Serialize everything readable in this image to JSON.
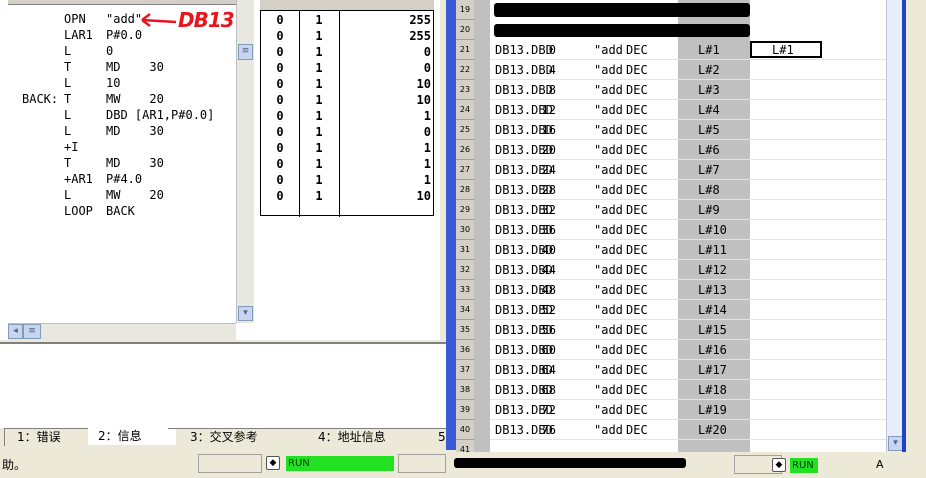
{
  "code": {
    "annotation": "DB13",
    "lines": [
      {
        "label": "",
        "op": "OPN",
        "arg": "\"add\""
      },
      {
        "label": "",
        "op": "LAR1",
        "arg": "P#0.0"
      },
      {
        "label": "",
        "op": "L",
        "arg": "0"
      },
      {
        "label": "",
        "op": "T",
        "arg": "MD    30"
      },
      {
        "label": "",
        "op": "L",
        "arg": "10"
      },
      {
        "label": "BACK:",
        "op": "T",
        "arg": "MW    20"
      },
      {
        "label": "",
        "op": "L",
        "arg": "DBD [AR1,P#0.0]"
      },
      {
        "label": "",
        "op": "L",
        "arg": "MD    30"
      },
      {
        "label": "",
        "op": "+I",
        "arg": ""
      },
      {
        "label": "",
        "op": "T",
        "arg": "MD    30"
      },
      {
        "label": "",
        "op": "+AR1",
        "arg": "P#4.0"
      },
      {
        "label": "",
        "op": "L",
        "arg": "MW    20"
      },
      {
        "label": "",
        "op": "LOOP",
        "arg": "BACK"
      }
    ]
  },
  "status_table": {
    "rows": [
      {
        "a": "0",
        "b": "1",
        "c": "255"
      },
      {
        "a": "0",
        "b": "1",
        "c": "255"
      },
      {
        "a": "0",
        "b": "1",
        "c": "0"
      },
      {
        "a": "0",
        "b": "1",
        "c": "0"
      },
      {
        "a": "0",
        "b": "1",
        "c": "10"
      },
      {
        "a": "0",
        "b": "1",
        "c": "10"
      },
      {
        "a": "0",
        "b": "1",
        "c": "1"
      },
      {
        "a": "0",
        "b": "1",
        "c": "0"
      },
      {
        "a": "0",
        "b": "1",
        "c": "1"
      },
      {
        "a": "0",
        "b": "1",
        "c": "1"
      },
      {
        "a": "0",
        "b": "1",
        "c": "1"
      },
      {
        "a": "0",
        "b": "1",
        "c": "10"
      }
    ]
  },
  "tabs": [
    "1：错误",
    "2：信息",
    "3：交叉参考",
    "4：地址信息",
    "5"
  ],
  "status_bar": {
    "left_text": "助。",
    "run_left": "RUN",
    "run_right": "RUN",
    "right_text": "A"
  },
  "var_table": {
    "row_numbers": [
      "19",
      "20",
      "21",
      "22",
      "23",
      "24",
      "25",
      "26",
      "27",
      "28",
      "29",
      "30",
      "31",
      "32",
      "33",
      "34",
      "35",
      "36",
      "37",
      "38",
      "39",
      "40",
      "41"
    ],
    "rows": [
      {
        "addr": "DB13.DBD",
        "off": "0",
        "sym": "\"add",
        "fmt": "DEC",
        "val": "L#1",
        "mod": "L#1"
      },
      {
        "addr": "DB13.DBD",
        "off": "4",
        "sym": "\"add",
        "fmt": "DEC",
        "val": "L#2",
        "mod": ""
      },
      {
        "addr": "DB13.DBD",
        "off": "8",
        "sym": "\"add",
        "fmt": "DEC",
        "val": "L#3",
        "mod": ""
      },
      {
        "addr": "DB13.DBD",
        "off": "12",
        "sym": "\"add",
        "fmt": "DEC",
        "val": "L#4",
        "mod": ""
      },
      {
        "addr": "DB13.DBD",
        "off": "16",
        "sym": "\"add",
        "fmt": "DEC",
        "val": "L#5",
        "mod": ""
      },
      {
        "addr": "DB13.DBD",
        "off": "20",
        "sym": "\"add",
        "fmt": "DEC",
        "val": "L#6",
        "mod": ""
      },
      {
        "addr": "DB13.DBD",
        "off": "24",
        "sym": "\"add",
        "fmt": "DEC",
        "val": "L#7",
        "mod": ""
      },
      {
        "addr": "DB13.DBD",
        "off": "28",
        "sym": "\"add",
        "fmt": "DEC",
        "val": "L#8",
        "mod": ""
      },
      {
        "addr": "DB13.DBD",
        "off": "32",
        "sym": "\"add",
        "fmt": "DEC",
        "val": "L#9",
        "mod": ""
      },
      {
        "addr": "DB13.DBD",
        "off": "36",
        "sym": "\"add",
        "fmt": "DEC",
        "val": "L#10",
        "mod": ""
      },
      {
        "addr": "DB13.DBD",
        "off": "40",
        "sym": "\"add",
        "fmt": "DEC",
        "val": "L#11",
        "mod": ""
      },
      {
        "addr": "DB13.DBD",
        "off": "44",
        "sym": "\"add",
        "fmt": "DEC",
        "val": "L#12",
        "mod": ""
      },
      {
        "addr": "DB13.DBD",
        "off": "48",
        "sym": "\"add",
        "fmt": "DEC",
        "val": "L#13",
        "mod": ""
      },
      {
        "addr": "DB13.DBD",
        "off": "52",
        "sym": "\"add",
        "fmt": "DEC",
        "val": "L#14",
        "mod": ""
      },
      {
        "addr": "DB13.DBD",
        "off": "56",
        "sym": "\"add",
        "fmt": "DEC",
        "val": "L#15",
        "mod": ""
      },
      {
        "addr": "DB13.DBD",
        "off": "60",
        "sym": "\"add",
        "fmt": "DEC",
        "val": "L#16",
        "mod": ""
      },
      {
        "addr": "DB13.DBD",
        "off": "64",
        "sym": "\"add",
        "fmt": "DEC",
        "val": "L#17",
        "mod": ""
      },
      {
        "addr": "DB13.DBD",
        "off": "68",
        "sym": "\"add",
        "fmt": "DEC",
        "val": "L#18",
        "mod": ""
      },
      {
        "addr": "DB13.DBD",
        "off": "72",
        "sym": "\"add",
        "fmt": "DEC",
        "val": "L#19",
        "mod": ""
      },
      {
        "addr": "DB13.DBD",
        "off": "76",
        "sym": "\"add",
        "fmt": "DEC",
        "val": "L#20",
        "mod": ""
      }
    ]
  },
  "colors": {
    "accent_red": "#e8141e",
    "run_green": "#22e022",
    "window_blue": "#1d44c8"
  }
}
